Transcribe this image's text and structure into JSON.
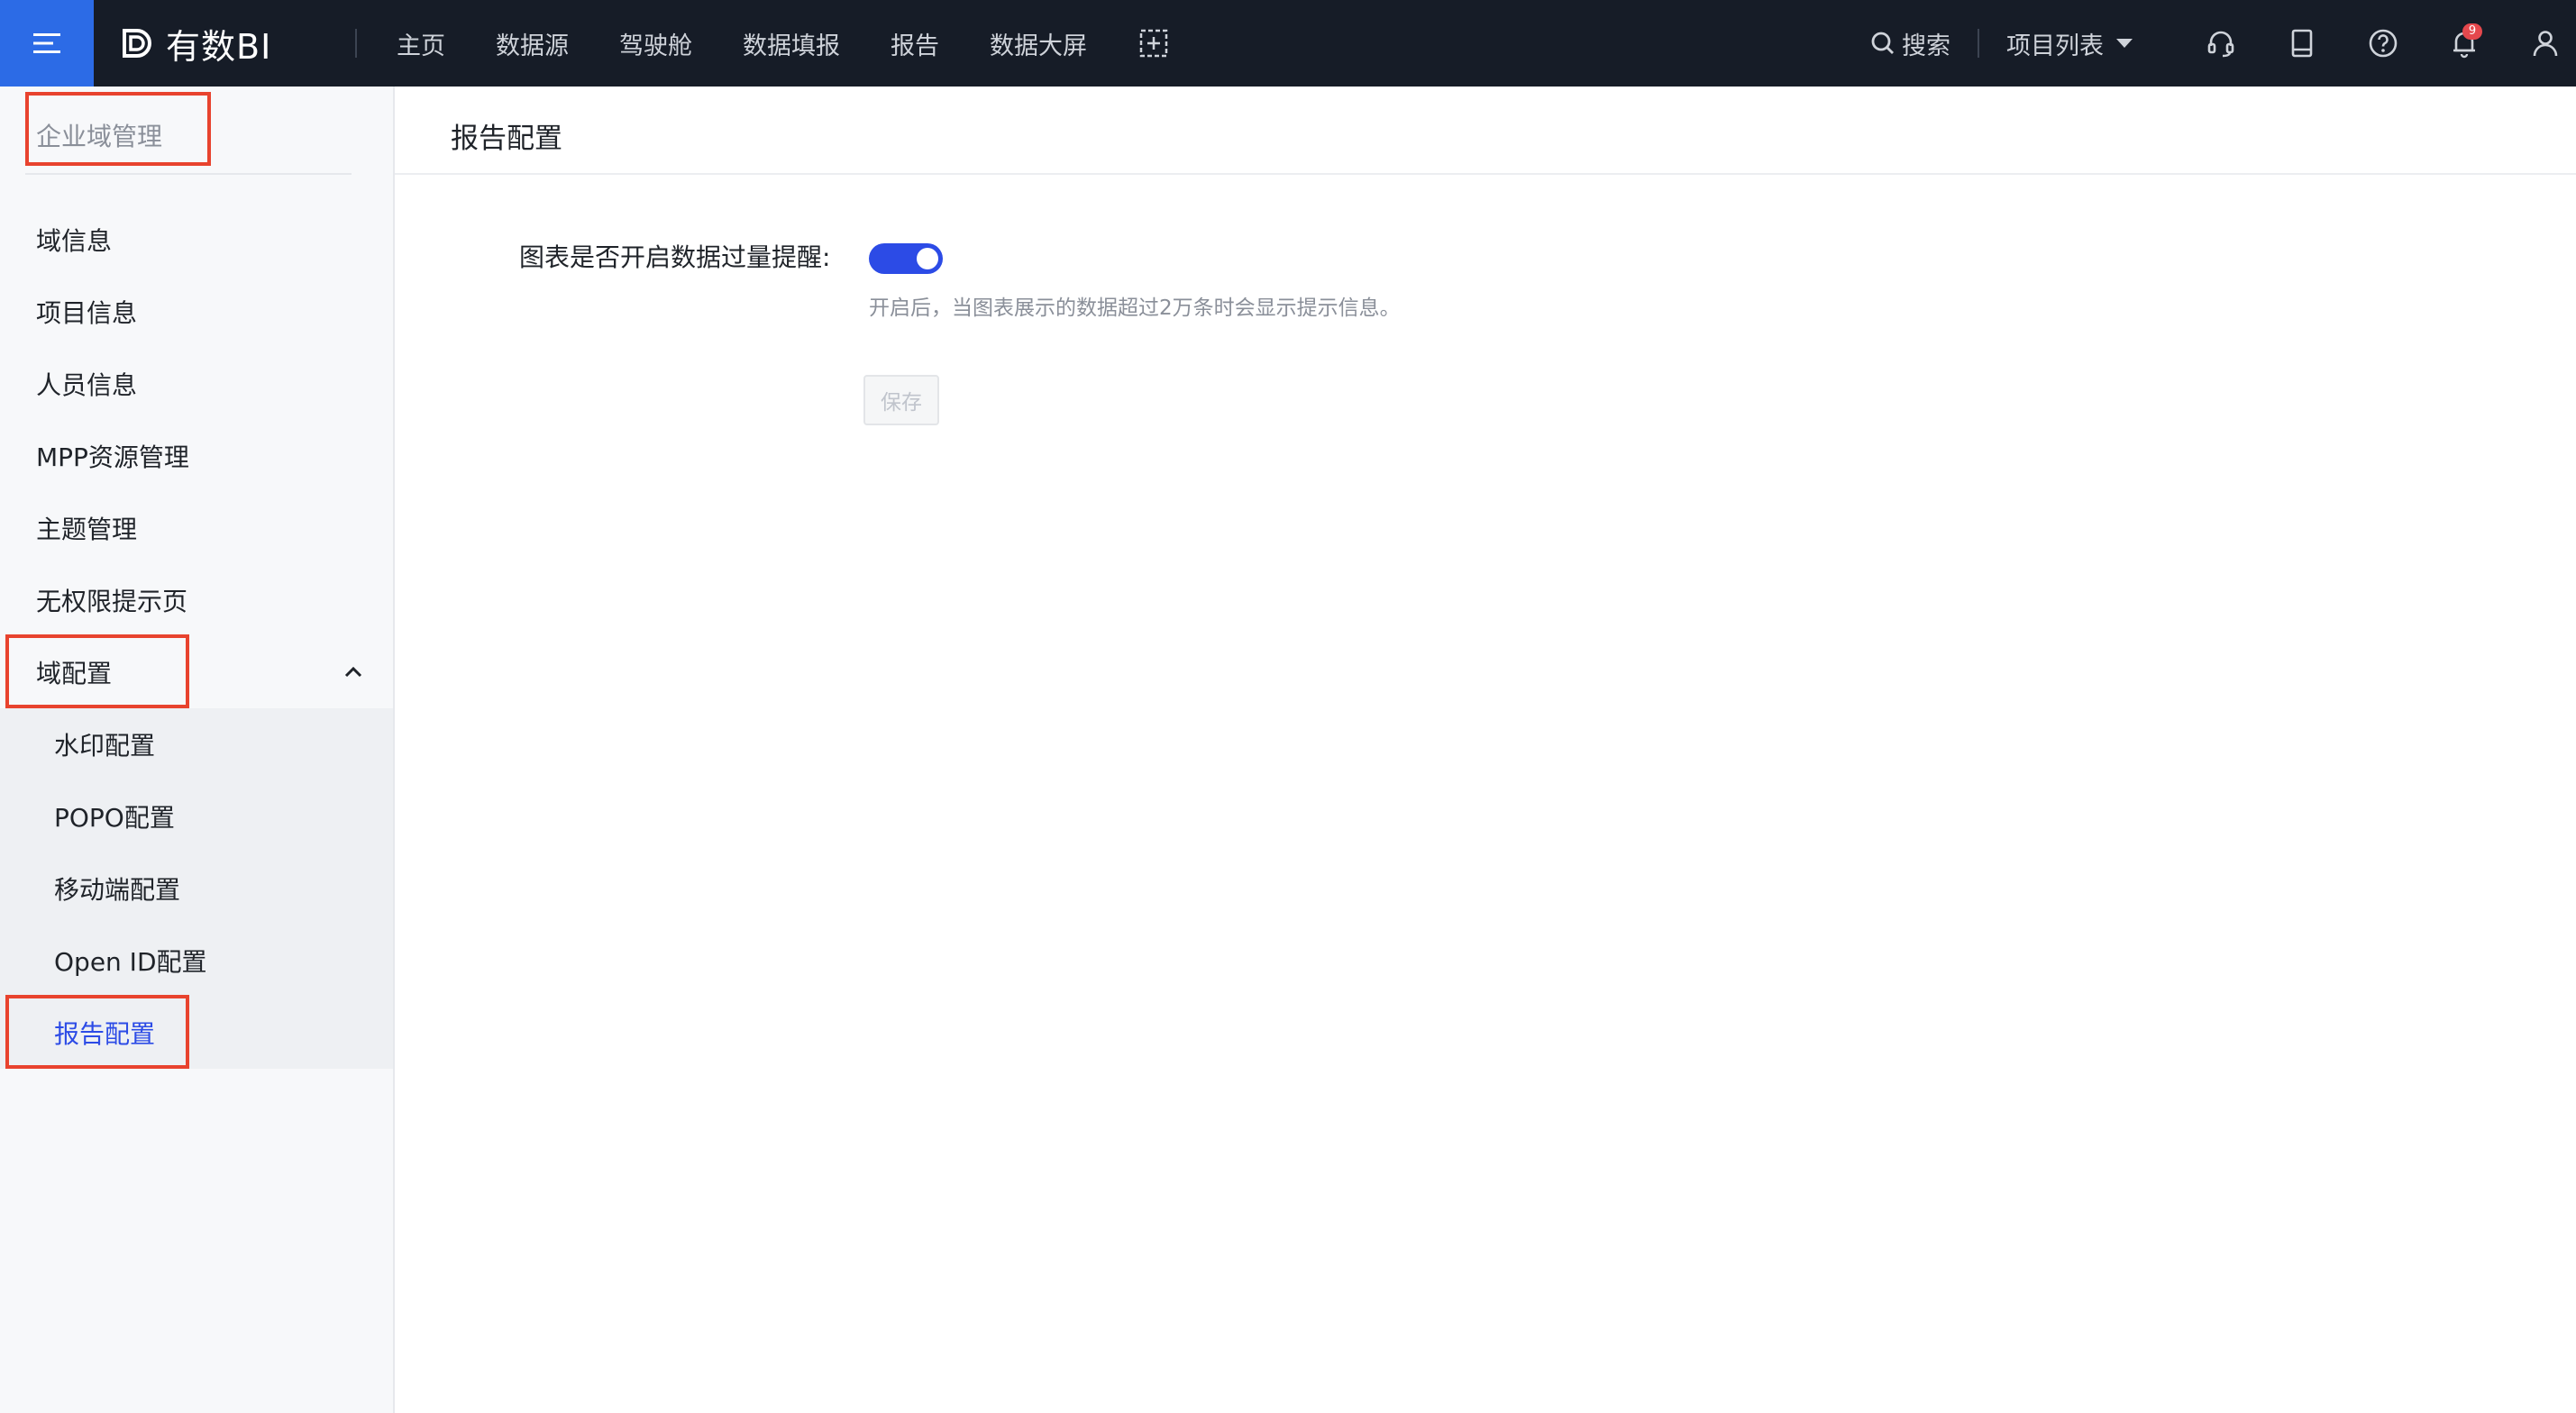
{
  "topbar": {
    "logo_text": "有数BI",
    "nav": [
      "主页",
      "数据源",
      "驾驶舱",
      "数据填报",
      "报告",
      "数据大屏"
    ],
    "search_label": "搜索",
    "project_list_label": "项目列表",
    "notification_count": "9",
    "icons": [
      "menu-icon",
      "logo-icon",
      "add-frame-icon",
      "search-icon",
      "caret-down-icon",
      "headset-icon",
      "tablet-icon",
      "help-icon",
      "bell-icon",
      "user-icon"
    ]
  },
  "sidebar": {
    "header": "企业域管理",
    "items": [
      "域信息",
      "项目信息",
      "人员信息",
      "MPP资源管理",
      "主题管理",
      "无权限提示页"
    ],
    "group": {
      "label": "域配置",
      "expanded": true,
      "children": [
        "水印配置",
        "POPO配置",
        "移动端配置",
        "Open ID配置",
        "报告配置"
      ],
      "active": "报告配置"
    }
  },
  "main": {
    "title": "报告配置",
    "field_label": "图表是否开启数据过量提醒:",
    "toggle_on": true,
    "hint": "开启后，当图表展示的数据超过2万条时会显示提示信息。",
    "save_label": "保存"
  },
  "colors": {
    "topbar_bg": "#161c27",
    "menu_btn_bg": "#2c6be6",
    "accent": "#2c4be6",
    "highlight_box": "#e8432e",
    "badge": "#e5484d"
  }
}
